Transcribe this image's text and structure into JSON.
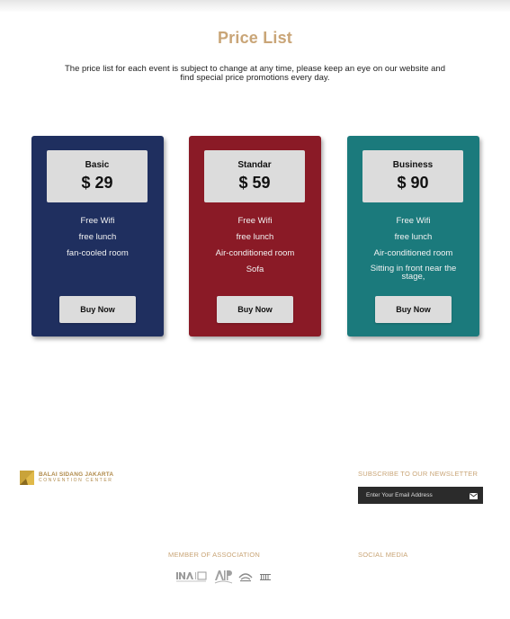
{
  "page": {
    "title": "Price List",
    "description": "The price list for each event is subject to change at any time, please keep an eye on our website and find special price promotions every day."
  },
  "plans": [
    {
      "name": "Basic",
      "price": "$ 29",
      "color": "#1f2f5f",
      "features": [
        "Free Wifi",
        "free lunch",
        "fan-cooled room"
      ],
      "button_label": "Buy Now"
    },
    {
      "name": "Standar",
      "price": "$ 59",
      "color": "#8a1a26",
      "features": [
        "Free Wifi",
        "free lunch",
        "Air-conditioned room",
        "Sofa"
      ],
      "button_label": "Buy Now"
    },
    {
      "name": "Business",
      "price": "$ 90",
      "color": "#1b7a7c",
      "features": [
        "Free Wifi",
        "free lunch",
        "Air-conditioned room",
        "Sitting in front near the stage,"
      ],
      "button_label": "Buy Now"
    }
  ],
  "footer": {
    "logo": {
      "line1": "BALAI SIDANG JAKARTA",
      "line2": "CONVENTION CENTER",
      "color": "#c9a33a"
    },
    "newsletter": {
      "heading": "SUBSCRIBE TO OUR NEWSLETTER",
      "placeholder": "Enter Your Email Address",
      "send_icon": "mail-icon"
    },
    "association": {
      "heading": "MEMBER OF ASSOCIATION",
      "logos": [
        "ina-icca-logo",
        "aipc-logo",
        "association-emblem-logo",
        "association-building-logo"
      ]
    },
    "social": {
      "heading": "SOCIAL MEDIA"
    },
    "accent_color": "#c9a577"
  }
}
